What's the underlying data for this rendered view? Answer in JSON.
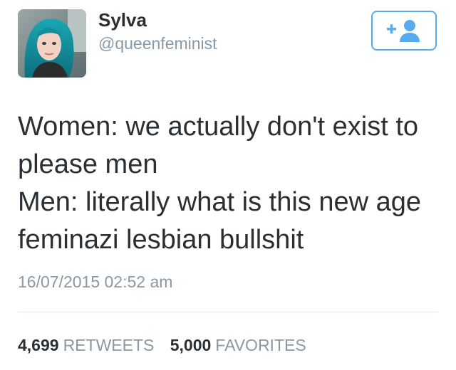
{
  "user": {
    "name": "Sylva",
    "handle": "@queenfeminist",
    "avatar": "profile-photo-teal-hair"
  },
  "follow_button": {
    "icon": "follow-user-plus-icon",
    "color": "#55acee"
  },
  "tweet": {
    "lines": [
      "Women: we actually don't exist to",
      "please men",
      "Men: literally what is this new age",
      "feminazi lesbian bullshit"
    ],
    "timestamp": "16/07/2015 02:52 am"
  },
  "stats": {
    "retweets_count": "4,699",
    "retweets_label": "RETWEETS",
    "favorites_count": "5,000",
    "favorites_label": "FAVORITES"
  },
  "colors": {
    "text": "#292f33",
    "secondary": "#8899a6",
    "accent": "#55acee",
    "divider": "#e1e8ed"
  }
}
